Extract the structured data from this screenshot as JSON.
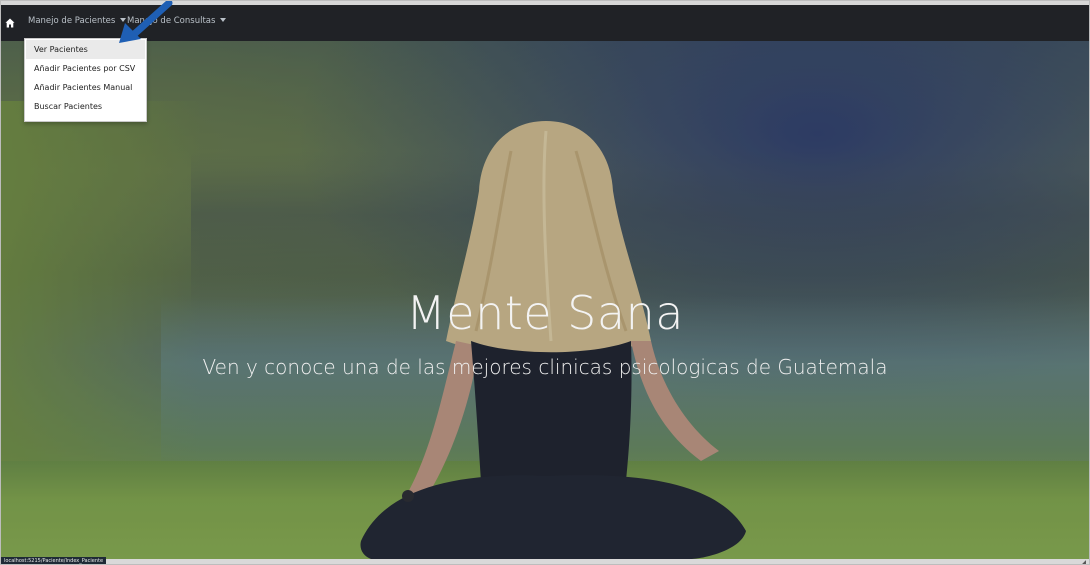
{
  "navbar": {
    "home_icon": "home-icon",
    "items": [
      {
        "label": "Manejo de Pacientes"
      },
      {
        "label": "Manejo de Consultas"
      }
    ]
  },
  "dropdown": {
    "items": [
      {
        "label": "Ver Pacientes"
      },
      {
        "label": "Añadir Pacientes por CSV"
      },
      {
        "label": "Añadir Pacientes Manual"
      },
      {
        "label": "Buscar Pacientes"
      }
    ]
  },
  "hero": {
    "title": "Mente Sana",
    "subtitle": "Ven y conoce una de las mejores clinicas psicologicas de Guatemala"
  },
  "status": {
    "url": "localhost:5215/Paciente/Index_Paciente"
  },
  "colors": {
    "navbar_bg": "#202226",
    "annotation_arrow": "#1f5fb4"
  }
}
